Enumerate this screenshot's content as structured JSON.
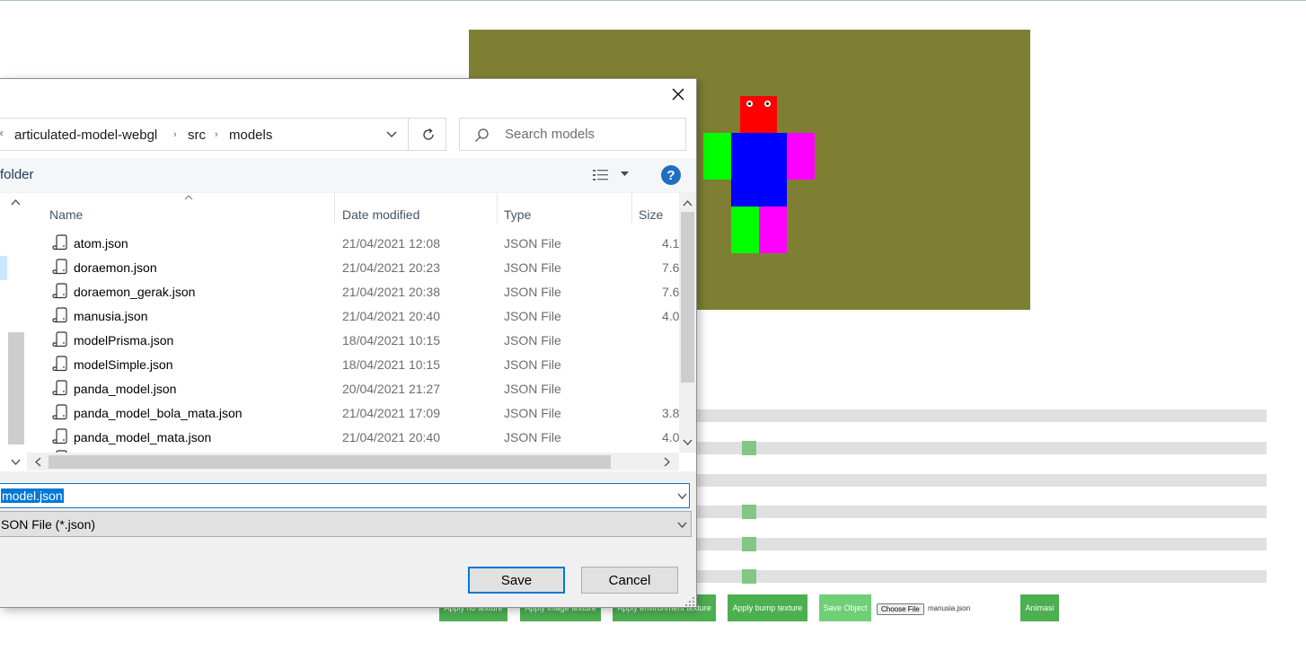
{
  "dialog": {
    "breadcrumb": {
      "overflow": "«",
      "parts": [
        "articulated-model-webgl",
        "src",
        "models"
      ]
    },
    "search_placeholder": "Search models",
    "new_folder_label": "folder",
    "help_label": "?",
    "columns": {
      "name": "Name",
      "date": "Date modified",
      "type": "Type",
      "size": "Size"
    },
    "files": [
      {
        "name": "atom.json",
        "date": "21/04/2021 12:08",
        "type": "JSON File",
        "size": "4.1"
      },
      {
        "name": "doraemon.json",
        "date": "21/04/2021 20:23",
        "type": "JSON File",
        "size": "7.6"
      },
      {
        "name": "doraemon_gerak.json",
        "date": "21/04/2021 20:38",
        "type": "JSON File",
        "size": "7.6"
      },
      {
        "name": "manusia.json",
        "date": "21/04/2021 20:40",
        "type": "JSON File",
        "size": "4.0"
      },
      {
        "name": "modelPrisma.json",
        "date": "18/04/2021 10:15",
        "type": "JSON File",
        "size": ""
      },
      {
        "name": "modelSimple.json",
        "date": "18/04/2021 10:15",
        "type": "JSON File",
        "size": ""
      },
      {
        "name": "panda_model.json",
        "date": "20/04/2021 21:27",
        "type": "JSON File",
        "size": ""
      },
      {
        "name": "panda_model_bola_mata.json",
        "date": "21/04/2021 17:09",
        "type": "JSON File",
        "size": "3.8"
      },
      {
        "name": "panda_model_mata.json",
        "date": "21/04/2021 20:40",
        "type": "JSON File",
        "size": "4.0"
      }
    ],
    "file_name_value": "model.json",
    "file_type_value": "SON File (*.json)",
    "save_label": "Save",
    "cancel_label": "Cancel"
  },
  "page": {
    "buttons": [
      "Apply no texture",
      "Apply image texture",
      "Apply environment texture",
      "Apply bump texture",
      "Save Object"
    ],
    "choose_file_label": "Choose File",
    "chosen_file": "manusia.json",
    "animate_label": "Animasi"
  },
  "colors": {
    "canvas_bg": "#7f7f34",
    "head": "#ff0000",
    "body": "#0000ff",
    "limb_green": "#00ff00",
    "limb_magenta": "#ff00ff",
    "button_green": "#4caf50",
    "accent_blue": "#0078d7"
  }
}
